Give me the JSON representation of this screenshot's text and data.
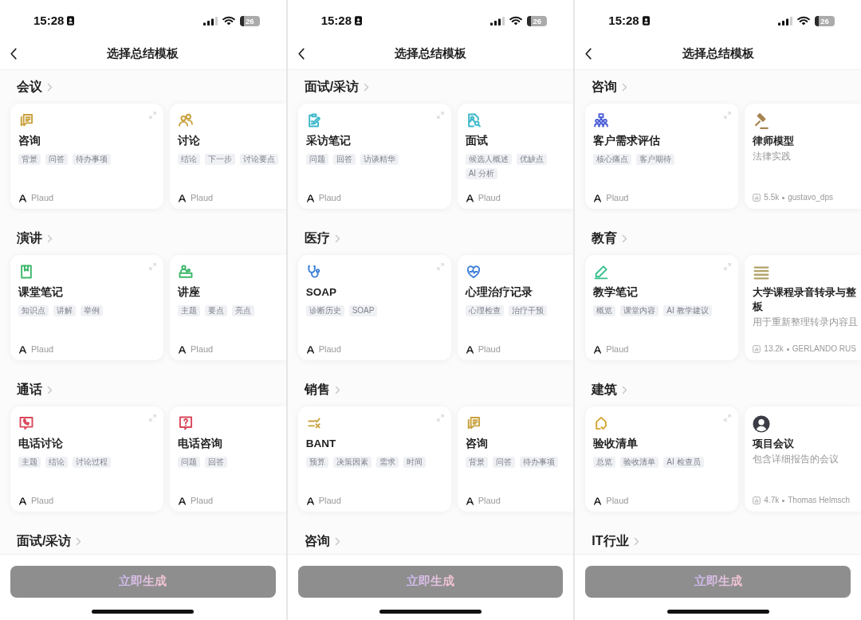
{
  "phones": [
    {
      "status_bar": {
        "time": "15:28",
        "battery": "26"
      },
      "header": {
        "title": "选择总结模板"
      },
      "sections": [
        {
          "title": "会议",
          "cards": [
            {
              "kind": "plaud",
              "title": "咨询",
              "color": "#c9a03c",
              "tags": [
                "背景",
                "问答",
                "待办事项"
              ],
              "author": "Plaud"
            },
            {
              "kind": "plaud",
              "title": "讨论",
              "color": "#c9a03c",
              "tags": [
                "结论",
                "下一步",
                "讨论要点"
              ],
              "author": "Plaud"
            }
          ]
        },
        {
          "title": "演讲",
          "cards": [
            {
              "kind": "plaud",
              "title": "课堂笔记",
              "color": "#3cb86a",
              "tags": [
                "知识点",
                "讲解",
                "举例"
              ],
              "author": "Plaud"
            },
            {
              "kind": "plaud",
              "title": "讲座",
              "color": "#3cb86a",
              "tags": [
                "主题",
                "要点",
                "亮点"
              ],
              "author": "Plaud"
            }
          ]
        },
        {
          "title": "通话",
          "cards": [
            {
              "kind": "plaud",
              "title": "电话讨论",
              "color": "#d9475a",
              "tags": [
                "主题",
                "结论",
                "讨论过程"
              ],
              "author": "Plaud"
            },
            {
              "kind": "plaud",
              "title": "电话咨询",
              "color": "#d9475a",
              "tags": [
                "问题",
                "回答"
              ],
              "author": "Plaud"
            }
          ]
        },
        {
          "title": "面试/采访"
        }
      ],
      "generate_button": {
        "label": "立即生成",
        "disabled": true
      }
    },
    {
      "status_bar": {
        "time": "15:28",
        "battery": "26"
      },
      "header": {
        "title": "选择总结模板"
      },
      "sections": [
        {
          "title": "面试/采访",
          "cards": [
            {
              "kind": "plaud",
              "title": "采访笔记",
              "color": "#3ab7c9",
              "tags": [
                "问题",
                "回答",
                "访谈精华"
              ],
              "author": "Plaud"
            },
            {
              "kind": "plaud",
              "title": "面试",
              "color": "#3ab7c9",
              "tags": [
                "候选人概述",
                "优缺点",
                "AI 分析"
              ],
              "author": "Plaud"
            }
          ]
        },
        {
          "title": "医疗",
          "cards": [
            {
              "kind": "plaud",
              "title": "SOAP",
              "color": "#3c7fd9",
              "tags": [
                "诊断历史",
                "SOAP"
              ],
              "author": "Plaud"
            },
            {
              "kind": "plaud",
              "title": "心理治疗记录",
              "color": "#3c7fd9",
              "tags": [
                "心理检查",
                "治疗干预"
              ],
              "author": "Plaud"
            }
          ]
        },
        {
          "title": "销售",
          "cards": [
            {
              "kind": "plaud",
              "title": "BANT",
              "color": "#c9a03c",
              "tags": [
                "预算",
                "决策因素",
                "需求",
                "时间"
              ],
              "author": "Plaud"
            },
            {
              "kind": "plaud",
              "title": "咨询",
              "color": "#c9a03c",
              "tags": [
                "背景",
                "问答",
                "待办事项"
              ],
              "author": "Plaud"
            }
          ]
        },
        {
          "title": "咨询"
        }
      ],
      "generate_button": {
        "label": "立即生成",
        "disabled": true
      }
    },
    {
      "status_bar": {
        "time": "15:28",
        "battery": "26"
      },
      "header": {
        "title": "选择总结模板"
      },
      "sections": [
        {
          "title": "咨询",
          "cards": [
            {
              "kind": "plaud",
              "title": "客户需求评估",
              "color": "#4a5cd6",
              "tags": [
                "核心痛点",
                "客户期待"
              ],
              "author": "Plaud"
            },
            {
              "kind": "community",
              "title": "律师模型",
              "color": "#a68450",
              "subtitle": "法律实践",
              "uses": "5.5k",
              "author": "gustavo_dps"
            }
          ]
        },
        {
          "title": "教育",
          "cards": [
            {
              "kind": "plaud",
              "title": "教学笔记",
              "color": "#35c08a",
              "tags": [
                "概览",
                "课堂内容",
                "AI 教学建议"
              ],
              "author": "Plaud"
            },
            {
              "kind": "community",
              "title": "大学课程录音转录与整板",
              "color": "#b3a26a",
              "subtitle": "用于重新整理转录内容且",
              "uses": "13.2k",
              "author": "GERLANDO RUS"
            }
          ]
        },
        {
          "title": "建筑",
          "cards": [
            {
              "kind": "plaud",
              "title": "验收清单",
              "color": "#d4a535",
              "tags": [
                "总览",
                "验收清单",
                "AI 检查员"
              ],
              "author": "Plaud"
            },
            {
              "kind": "community",
              "title": "项目会议",
              "color": "#3a3d45",
              "subtitle": "包含详细报告的会议",
              "uses": "4.7k",
              "author": "Thomas Helmsch"
            }
          ]
        },
        {
          "title": "IT行业"
        }
      ],
      "generate_button": {
        "label": "立即生成",
        "disabled": true
      }
    }
  ]
}
